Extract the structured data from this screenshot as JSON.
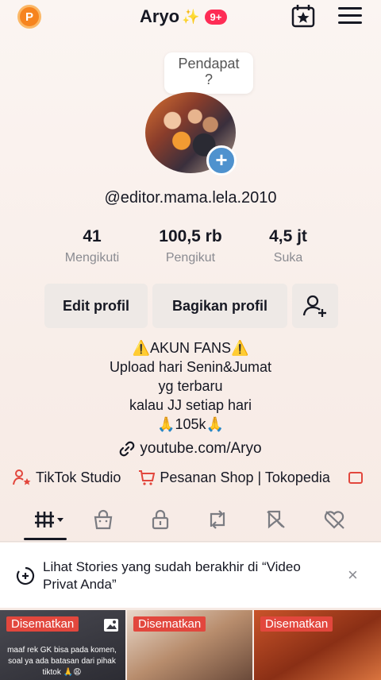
{
  "header": {
    "p_badge": "P",
    "title": "Aryo",
    "sparkle": "✨",
    "notification_count": "9+"
  },
  "profile": {
    "note_line1": "Pendapat",
    "note_line2": "?",
    "add_symbol": "+",
    "username": "@editor.mama.lela.2010"
  },
  "stats": [
    {
      "value": "41",
      "label": "Mengikuti"
    },
    {
      "value": "100,5 rb",
      "label": "Pengikut"
    },
    {
      "value": "4,5 jt",
      "label": "Suka"
    }
  ],
  "buttons": {
    "edit": "Edit profil",
    "share": "Bagikan profil"
  },
  "bio": [
    "⚠️AKUN FANS⚠️",
    "Upload hari Senin&Jumat",
    "yg terbaru",
    "kalau JJ setiap hari",
    "🙏105k🙏"
  ],
  "link": "youtube.com/Aryo",
  "shortcuts": [
    {
      "label": "TikTok Studio",
      "icon": "person-star-icon"
    },
    {
      "label": "Pesanan Shop | Tokopedia",
      "icon": "cart-icon"
    }
  ],
  "tabs": [
    "videos-grid-icon",
    "shop-bag-icon",
    "lock-icon",
    "repost-icon",
    "favorites-icon",
    "liked-icon"
  ],
  "stories_banner": {
    "text": "Lihat Stories yang sudah berakhir di “Video Privat Anda”",
    "close": "×"
  },
  "grid": [
    {
      "pinned": "Disematkan",
      "caption": "maaf rek GK bisa pada komen, soal ya ada batasan dari pihak tiktok 🙏😩"
    },
    {
      "pinned": "Disematkan",
      "caption": ""
    },
    {
      "pinned": "Disematkan",
      "caption": ""
    }
  ],
  "colors": {
    "accent": "#fe2c55",
    "pinned_badge": "#e2473d",
    "plus_button": "#4f92ce"
  }
}
